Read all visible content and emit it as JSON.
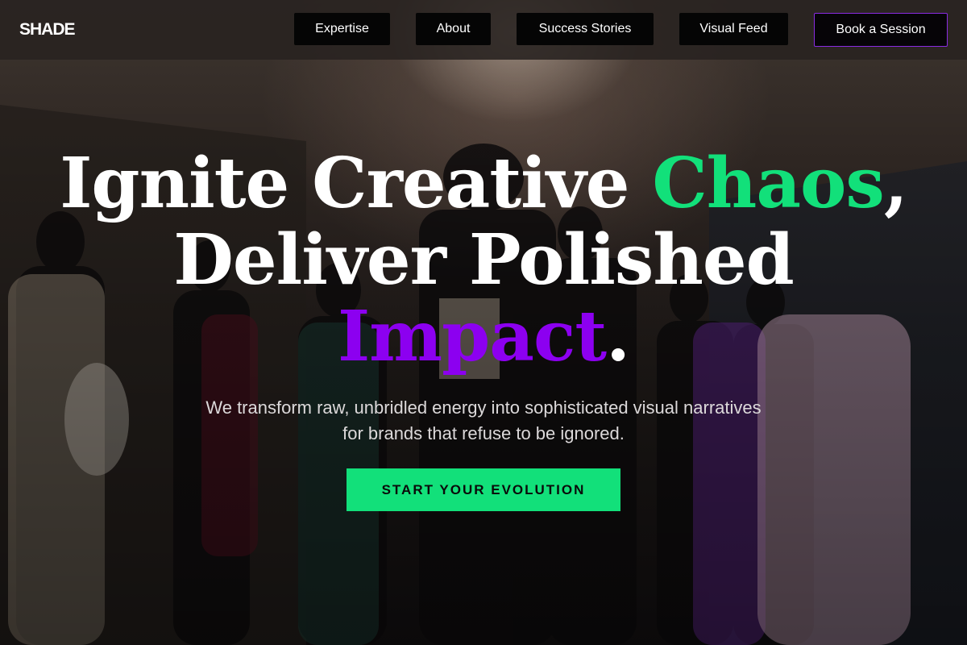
{
  "header": {
    "logo": "SHADE",
    "nav": [
      {
        "label": "Expertise"
      },
      {
        "label": "About"
      },
      {
        "label": "Success Stories"
      },
      {
        "label": "Visual Feed"
      }
    ],
    "cta_label": "Book a Session"
  },
  "hero": {
    "headline": {
      "part1": "Ignite Creative ",
      "highlight1": "Chaos",
      "part2": ",",
      "line2": "Deliver Polished",
      "highlight2": "Impact",
      "part3": "."
    },
    "subtext": "We transform raw, unbridled energy into sophisticated visual narratives for brands that refuse to be ignored.",
    "cta_label": "START YOUR EVOLUTION"
  },
  "colors": {
    "accent_green": "#12e07a",
    "accent_purple": "#8c00f0",
    "nav_border": "#8a2be2"
  }
}
